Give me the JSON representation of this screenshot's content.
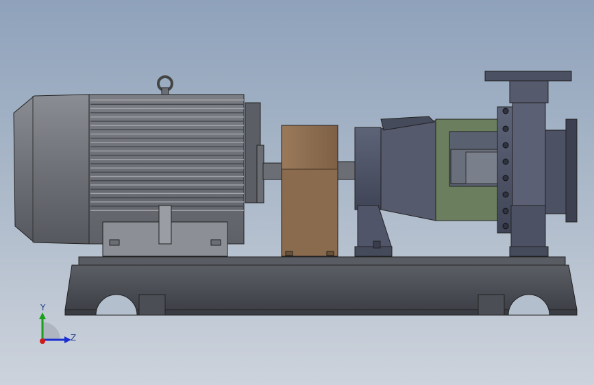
{
  "viewport": {
    "background_top": "#8fa2bb",
    "background_bottom": "#cdd3dc"
  },
  "triad": {
    "y_label": "Y",
    "z_label": "Z",
    "y_color": "#1aa01a",
    "z_color": "#1a2fd0",
    "x_color": "#d01a1a"
  },
  "colors": {
    "motor": "#6c6f76",
    "coupling_guard": "#8a6b4e",
    "bearing_frame": "#6b7f5e",
    "pump_casing": "#4f5568",
    "base_frame": "#4a4c54"
  }
}
